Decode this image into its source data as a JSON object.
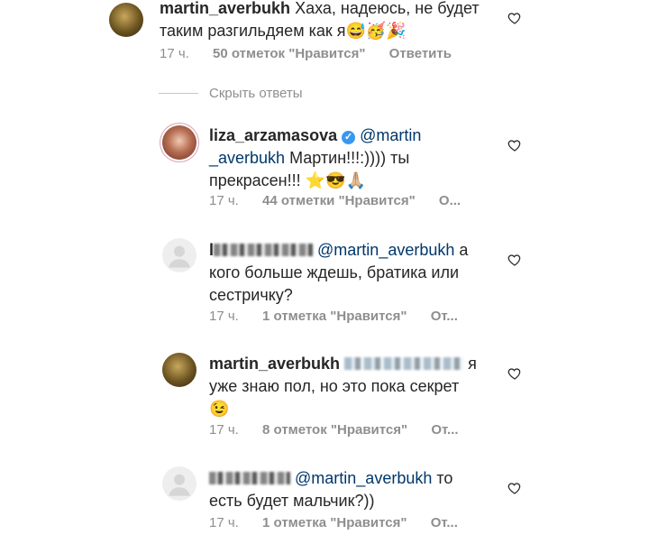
{
  "top_comment": {
    "username": "martin_averbukh",
    "text_line1": "Хаха, надеюсь, не будет",
    "text_line2": "таким разгильдяем как я😅🥳🎉",
    "time": "17 ч.",
    "likes": "50 отметок \"Нравится\"",
    "reply": "Ответить"
  },
  "hide_replies": "Скрыть ответы",
  "replies": [
    {
      "username": "liza_arzamasova",
      "mention": "@martin",
      "mention_cont": "_averbukh",
      "text_after": "Мартин!!!:)))) ты",
      "text_line3": "прекрасен!!! ⭐😎🙏🏼",
      "time": "17 ч.",
      "likes": "44 отметки \"Нравится\"",
      "reply": "О..."
    },
    {
      "username_visible": "l",
      "mention": "@martin_averbukh",
      "text_after": "а",
      "text_line2": "кого больше ждешь, братика или",
      "text_line3": "сестричку?",
      "time": "17 ч.",
      "likes": "1 отметка \"Нравится\"",
      "reply": "От..."
    },
    {
      "username": "martin_averbukh",
      "text_after": "я",
      "text_line2": "уже знаю пол, но это пока секрет",
      "text_line3": "😉",
      "time": "17 ч.",
      "likes": "8 отметок \"Нравится\"",
      "reply": "От..."
    },
    {
      "mention": "@martin_averbukh",
      "text_after": "то",
      "text_line2": "есть будет мальчик?))",
      "time": "17 ч.",
      "likes": "1 отметка \"Нравится\"",
      "reply": "От..."
    }
  ],
  "colors": {
    "text": "#262626",
    "muted": "#8e8e8e",
    "mention": "#00376b",
    "verified": "#3897f0"
  },
  "icons": {
    "like": "heart-outline-icon",
    "default_avatar": "person-silhouette-icon"
  }
}
